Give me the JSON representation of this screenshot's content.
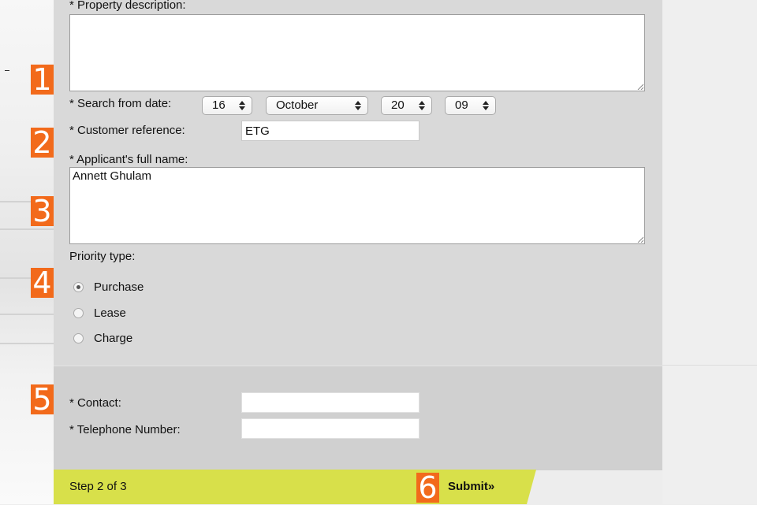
{
  "form": {
    "property_description": {
      "label": "* Property description:",
      "value": ""
    },
    "search_from_date": {
      "label": "* Search from date:",
      "day": "16",
      "month": "October",
      "century": "20",
      "year": "09"
    },
    "customer_reference": {
      "label": "* Customer reference:",
      "value": "ETG"
    },
    "applicant_name": {
      "label": "* Applicant's full name:",
      "value": "Annett Ghulam"
    },
    "priority": {
      "label": "Priority type:",
      "options": [
        "Purchase",
        "Lease",
        "Charge"
      ],
      "selected": "Purchase"
    },
    "contact": {
      "label": "* Contact:",
      "value": ""
    },
    "telephone": {
      "label": "* Telephone Number:",
      "value": ""
    }
  },
  "footer": {
    "step": "Step 2 of 3",
    "submit": "Submit»"
  },
  "callouts": [
    "1",
    "2",
    "3",
    "4",
    "5",
    "6"
  ],
  "colors": {
    "callout": "#f26a1b",
    "footer_bar": "#d8e04a",
    "panel": "#d9d9d9"
  },
  "icons": [
    "select-arrow-icon",
    "resize-grip-icon"
  ]
}
